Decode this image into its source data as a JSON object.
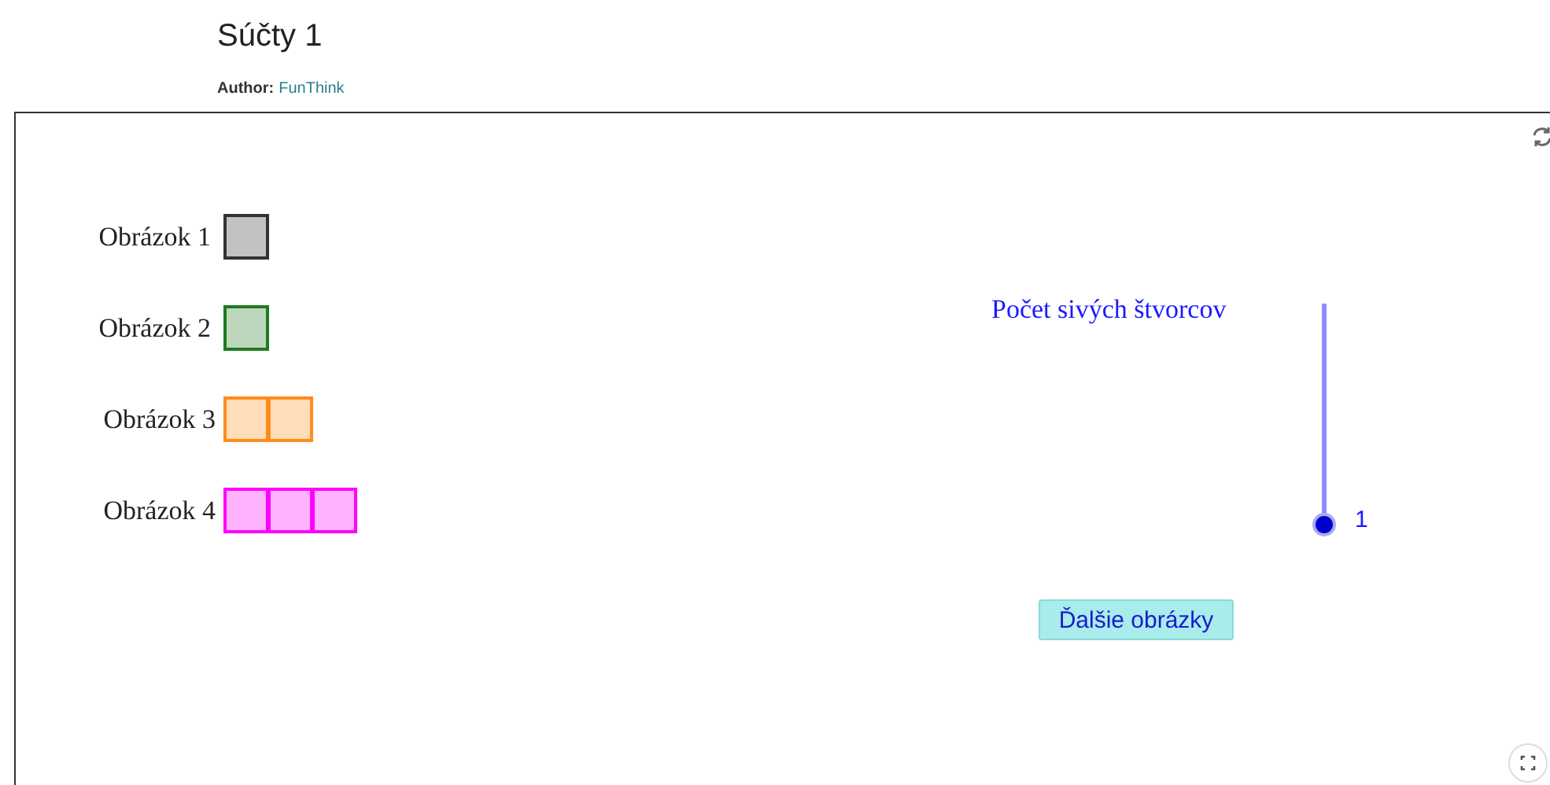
{
  "header": {
    "title": "Súčty 1",
    "author_label": "Author:",
    "author": "FunThink"
  },
  "figures": [
    {
      "label": "Obrázok 1",
      "cells": [
        {
          "color": "#333333"
        }
      ]
    },
    {
      "label": "Obrázok 2",
      "cells": [
        {
          "color": "#1e7a1e"
        }
      ]
    },
    {
      "label": "Obrázok 3",
      "cells": [
        {
          "color": "#ff8c1a"
        },
        {
          "color": "#ff8c1a"
        }
      ]
    },
    {
      "label": "Obrázok 4",
      "cells": [
        {
          "color": "#ff00ff"
        },
        {
          "color": "#ff00ff"
        },
        {
          "color": "#ff00ff"
        }
      ]
    }
  ],
  "slider": {
    "label": "Počet sivých štvorcov",
    "level": 0,
    "value": "1"
  },
  "button": {
    "label": "Ďalšie obrázky"
  }
}
